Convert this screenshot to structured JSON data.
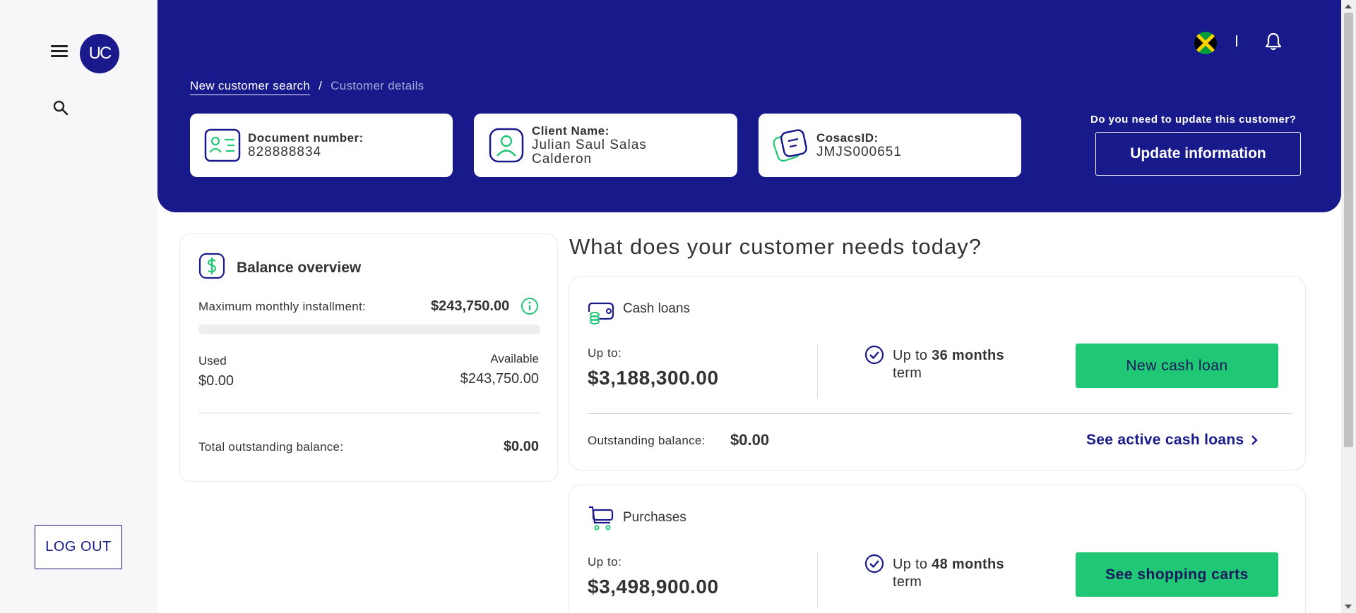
{
  "sidebar": {
    "logo_text": "UC",
    "menu_icon": "hamburger-icon",
    "search_icon": "search-icon",
    "logout_label": "LOG OUT"
  },
  "header": {
    "divider": "|",
    "flag_icon": "jamaica-flag-icon",
    "bell_icon": "bell-icon",
    "breadcrumb": {
      "link": "New customer search",
      "separator": "/",
      "current": "Customer details"
    },
    "cards": {
      "document": {
        "label": "Document number:",
        "value": "828888834",
        "icon": "id-card-icon"
      },
      "client": {
        "label": "Client Name:",
        "value_line1": "Julian Saul Salas",
        "value_line2": "Calderon",
        "icon": "user-icon"
      },
      "cosacs": {
        "label": "CosacsID:",
        "value": "JMJS000651",
        "icon": "document-icon"
      }
    },
    "update_question": "Do you need to update this customer?",
    "update_button": "Update information"
  },
  "balance": {
    "title": "Balance overview",
    "icon": "dollar-icon",
    "max_label": "Maximum monthly installment:",
    "max_value": "$243,750.00",
    "used_fraction": 0,
    "used_label": "Used",
    "used_value": "$0.00",
    "available_label": "Available",
    "available_value": "$243,750.00",
    "total_label": "Total outstanding balance:",
    "total_value": "$0.00"
  },
  "main": {
    "title": "What does your customer needs today?",
    "cash": {
      "title": "Cash loans",
      "upto_label": "Up to:",
      "upto_value": "$3,188,300.00",
      "term_prefix": "Up to",
      "term_bold": "36 months",
      "term_suffix": "term",
      "button": "New cash loan",
      "ob_label": "Outstanding balance:",
      "ob_value": "$0.00",
      "link": "See active cash loans"
    },
    "purchases": {
      "title": "Purchases",
      "upto_label": "Up to:",
      "upto_value": "$3,498,900.00",
      "term_prefix": "Up to",
      "term_bold": "48 months",
      "term_suffix": "term",
      "button": "See shopping carts"
    }
  },
  "colors": {
    "primary": "#181a8c",
    "accent_green": "#20c774",
    "sidebar_bg": "#f7f7f9"
  }
}
